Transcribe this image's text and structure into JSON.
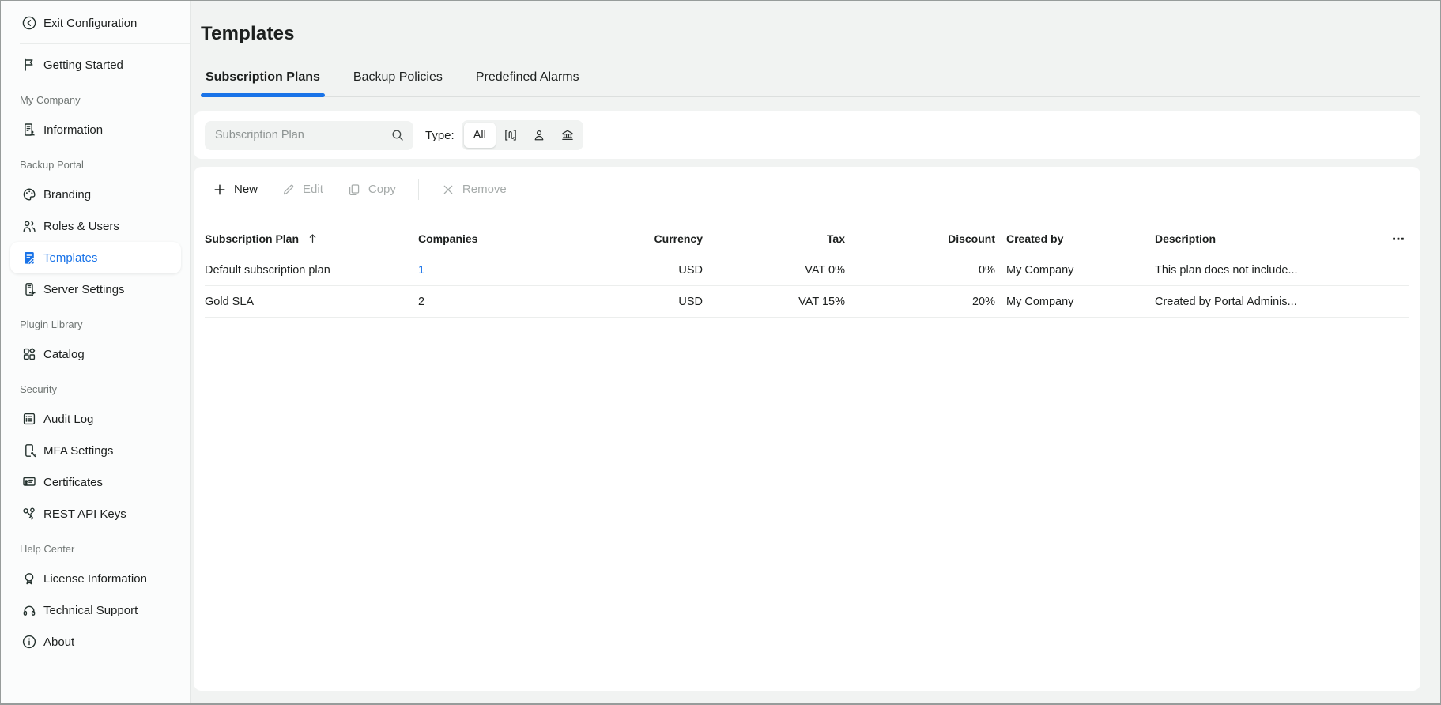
{
  "sidebar": {
    "exit": {
      "label": "Exit Configuration",
      "icon": "chevron-left-circle-icon"
    },
    "groups": [
      {
        "section": "",
        "items": [
          {
            "label": "Getting Started",
            "icon": "flag-icon",
            "active": false
          }
        ]
      },
      {
        "section": "My Company",
        "items": [
          {
            "label": "Information",
            "icon": "building-person-icon",
            "active": false
          }
        ]
      },
      {
        "section": "Backup Portal",
        "items": [
          {
            "label": "Branding",
            "icon": "palette-icon",
            "active": false
          },
          {
            "label": "Roles & Users",
            "icon": "users-icon",
            "active": false
          },
          {
            "label": "Templates",
            "icon": "clipboard-pen-icon",
            "active": true
          },
          {
            "label": "Server Settings",
            "icon": "server-gear-icon",
            "active": false
          }
        ]
      },
      {
        "section": "Plugin Library",
        "items": [
          {
            "label": "Catalog",
            "icon": "grid-diamond-icon",
            "active": false
          }
        ]
      },
      {
        "section": "Security",
        "items": [
          {
            "label": "Audit Log",
            "icon": "list-box-icon",
            "active": false
          },
          {
            "label": "MFA Settings",
            "icon": "phone-key-icon",
            "active": false
          },
          {
            "label": "Certificates",
            "icon": "certificate-icon",
            "active": false
          },
          {
            "label": "REST API Keys",
            "icon": "keys-icon",
            "active": false
          }
        ]
      },
      {
        "section": "Help Center",
        "items": [
          {
            "label": "License Information",
            "icon": "medal-icon",
            "active": false
          },
          {
            "label": "Technical Support",
            "icon": "headset-icon",
            "active": false
          },
          {
            "label": "About",
            "icon": "info-circle-icon",
            "active": false
          }
        ]
      }
    ]
  },
  "header": {
    "title": "Templates",
    "tabs": [
      {
        "label": "Subscription Plans",
        "active": true
      },
      {
        "label": "Backup Policies",
        "active": false
      },
      {
        "label": "Predefined Alarms",
        "active": false
      }
    ]
  },
  "filters": {
    "search_placeholder": "Subscription Plan",
    "search_icon": "search-icon",
    "type_label": "Type:",
    "type_options": [
      {
        "label": "All",
        "selected": true
      },
      {
        "icon": "scroll-icon",
        "selected": false
      },
      {
        "icon": "user-icon",
        "selected": false
      },
      {
        "icon": "bank-icon",
        "selected": false
      }
    ]
  },
  "toolbar": {
    "new_label": "New",
    "edit_label": "Edit",
    "copy_label": "Copy",
    "remove_label": "Remove",
    "enabled": {
      "new": true,
      "edit": false,
      "copy": false,
      "remove": false
    }
  },
  "table": {
    "columns": [
      "Subscription Plan",
      "Companies",
      "Currency",
      "Tax",
      "Discount",
      "Created by",
      "Description"
    ],
    "sort": {
      "column": "Subscription Plan",
      "direction": "asc",
      "icon": "sort-ascending-icon"
    },
    "column_menu_icon": "ellipsis-icon",
    "rows": [
      {
        "plan": "Default subscription plan",
        "companies": "1",
        "companies_is_link": true,
        "currency": "USD",
        "tax": "VAT 0%",
        "discount": "0%",
        "created_by": "My Company",
        "description": "This plan does not include..."
      },
      {
        "plan": "Gold SLA",
        "companies": "2",
        "companies_is_link": false,
        "currency": "USD",
        "tax": "VAT 15%",
        "discount": "20%",
        "created_by": "My Company",
        "description": "Created by Portal Adminis..."
      }
    ]
  },
  "colors": {
    "accent": "#1973e8",
    "page_bg": "#f1f3f2",
    "sidebar_bg": "#fbfcfc",
    "panel_bg": "#ffffff",
    "text": "#1d201f",
    "muted": "#6f7573",
    "disabled": "#a7acab",
    "border": "#e4e7e6",
    "window_border": "#979c9b"
  }
}
